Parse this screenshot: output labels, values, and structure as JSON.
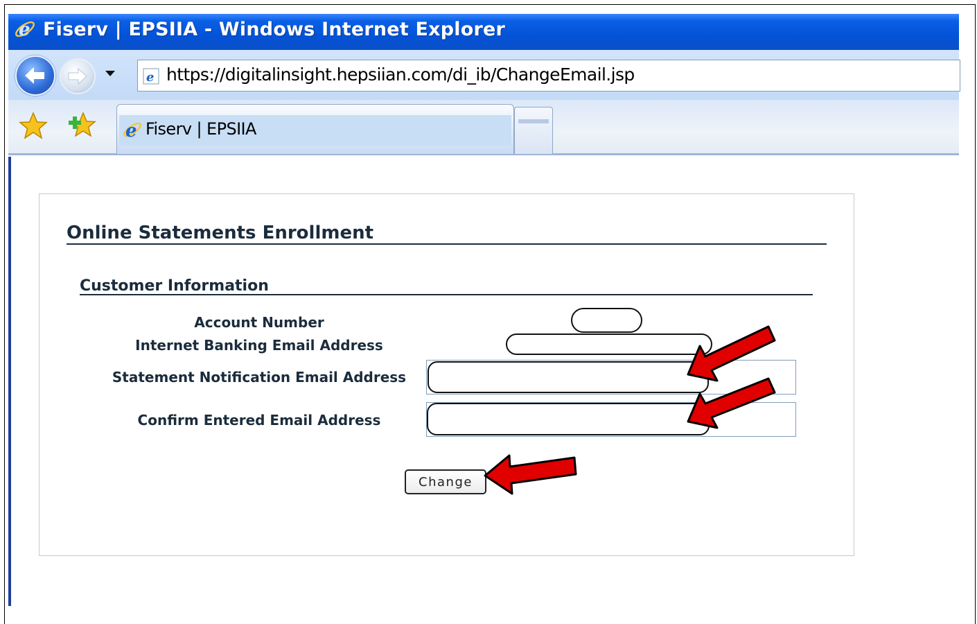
{
  "window": {
    "title": "Fiserv | EPSIIA - Windows Internet Explorer",
    "icon": "ie-icon"
  },
  "navigation": {
    "back_icon": "back-arrow-icon",
    "forward_icon": "forward-arrow-icon",
    "address_url": "https://digitalinsight.hepsiian.com/di_ib/ChangeEmail.jsp"
  },
  "tabs": {
    "favorites_icon": "star-icon",
    "add_favorites_icon": "add-star-icon",
    "active_label": "Fiserv | EPSIIA"
  },
  "page": {
    "title": "Online Statements Enrollment",
    "section_title": "Customer Information",
    "fields": {
      "account_number_label": "Account Number",
      "internet_banking_email_label": "Internet Banking Email Address",
      "statement_notification_email_label": "Statement Notification Email Address",
      "confirm_email_label": "Confirm Entered Email Address"
    },
    "change_button": "Change"
  },
  "annotations": {
    "arrow_color": "#e00000"
  }
}
